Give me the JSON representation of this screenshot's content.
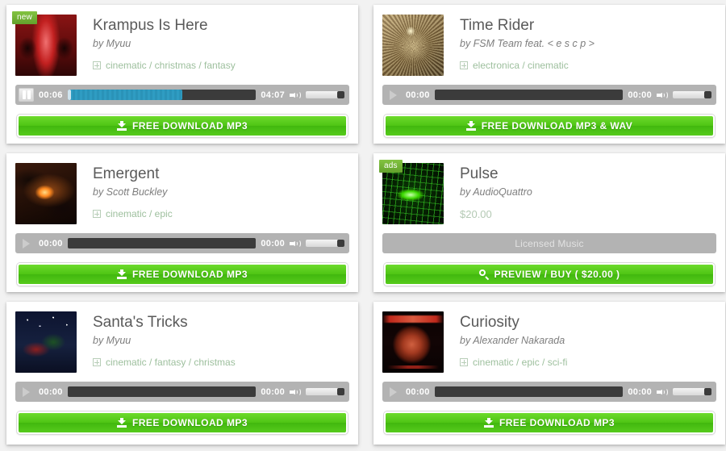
{
  "page": {
    "background_color": "#f2f2f2",
    "card_background": "#ffffff",
    "accent_green": "#4ec414",
    "badge_green": "#76b82a",
    "player_bar_color": "#b3b3b3",
    "progress_played_color": "#2f9cc2"
  },
  "tracks": [
    {
      "badge": "new",
      "art": "art-krampus",
      "art_name": "album-art-krampus-is-here",
      "title": "Krampus Is Here",
      "artist": "by Myuu",
      "tags": "cinematic / christmas / fantasy",
      "player": {
        "state": "playing",
        "control_icon": "pause-icon",
        "current_time": "00:06",
        "total_time": "04:07",
        "progress_percent": 61,
        "volume_percent": 100
      },
      "button": {
        "label": "FREE DOWNLOAD  MP3",
        "icon": "download-icon",
        "style": "green"
      }
    },
    {
      "badge": null,
      "art": "art-time",
      "art_name": "album-art-time-rider",
      "title": "Time Rider",
      "artist": "by FSM Team feat. < e s c p >",
      "tags": "electronica / cinematic",
      "player": {
        "state": "paused",
        "control_icon": "play-icon",
        "current_time": "00:00",
        "total_time": "00:00",
        "progress_percent": 0,
        "volume_percent": 100
      },
      "button": {
        "label": "FREE DOWNLOAD  MP3 & WAV",
        "icon": "download-icon",
        "style": "green"
      }
    },
    {
      "badge": null,
      "art": "art-emergent",
      "art_name": "album-art-emergent",
      "title": "Emergent",
      "artist": "by Scott Buckley",
      "tags": "cinematic / epic",
      "player": {
        "state": "paused",
        "control_icon": "play-icon",
        "current_time": "00:00",
        "total_time": "00:00",
        "progress_percent": 0,
        "volume_percent": 100
      },
      "button": {
        "label": "FREE DOWNLOAD  MP3",
        "icon": "download-icon",
        "style": "green"
      }
    },
    {
      "badge": "ads",
      "art": "art-pulse",
      "art_name": "album-art-pulse",
      "title": "Pulse",
      "artist": "by AudioQuattro",
      "price": "$20.00",
      "licensed_label": "Licensed Music",
      "button": {
        "label": "PREVIEW / BUY ( $20.00 )",
        "icon": "search-icon",
        "style": "green"
      }
    },
    {
      "badge": null,
      "art": "art-santa",
      "art_name": "album-art-santas-tricks",
      "title": "Santa's Tricks",
      "artist": "by Myuu",
      "tags": "cinematic / fantasy / christmas",
      "player": {
        "state": "paused",
        "control_icon": "play-icon",
        "current_time": "00:00",
        "total_time": "00:00",
        "progress_percent": 0,
        "volume_percent": 100
      },
      "button": {
        "label": "FREE DOWNLOAD  MP3",
        "icon": "download-icon",
        "style": "green"
      }
    },
    {
      "badge": null,
      "art": "art-curiosity",
      "art_name": "album-art-curiosity",
      "title": "Curiosity",
      "artist": "by Alexander Nakarada",
      "tags": "cinematic / epic / sci-fi",
      "player": {
        "state": "paused",
        "control_icon": "play-icon",
        "current_time": "00:00",
        "total_time": "00:00",
        "progress_percent": 0,
        "volume_percent": 100
      },
      "button": {
        "label": "FREE DOWNLOAD  MP3",
        "icon": "download-icon",
        "style": "green"
      }
    }
  ]
}
